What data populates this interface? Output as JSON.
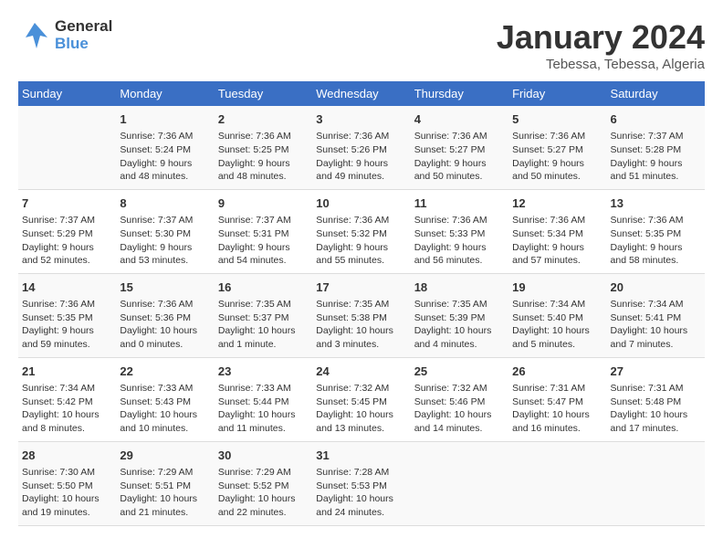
{
  "logo": {
    "general": "General",
    "blue": "Blue"
  },
  "title": "January 2024",
  "subtitle": "Tebessa, Tebessa, Algeria",
  "days_of_week": [
    "Sunday",
    "Monday",
    "Tuesday",
    "Wednesday",
    "Thursday",
    "Friday",
    "Saturday"
  ],
  "weeks": [
    [
      {
        "day": "",
        "info": ""
      },
      {
        "day": "1",
        "info": "Sunrise: 7:36 AM\nSunset: 5:24 PM\nDaylight: 9 hours\nand 48 minutes."
      },
      {
        "day": "2",
        "info": "Sunrise: 7:36 AM\nSunset: 5:25 PM\nDaylight: 9 hours\nand 48 minutes."
      },
      {
        "day": "3",
        "info": "Sunrise: 7:36 AM\nSunset: 5:26 PM\nDaylight: 9 hours\nand 49 minutes."
      },
      {
        "day": "4",
        "info": "Sunrise: 7:36 AM\nSunset: 5:27 PM\nDaylight: 9 hours\nand 50 minutes."
      },
      {
        "day": "5",
        "info": "Sunrise: 7:36 AM\nSunset: 5:27 PM\nDaylight: 9 hours\nand 50 minutes."
      },
      {
        "day": "6",
        "info": "Sunrise: 7:37 AM\nSunset: 5:28 PM\nDaylight: 9 hours\nand 51 minutes."
      }
    ],
    [
      {
        "day": "7",
        "info": "Sunrise: 7:37 AM\nSunset: 5:29 PM\nDaylight: 9 hours\nand 52 minutes."
      },
      {
        "day": "8",
        "info": "Sunrise: 7:37 AM\nSunset: 5:30 PM\nDaylight: 9 hours\nand 53 minutes."
      },
      {
        "day": "9",
        "info": "Sunrise: 7:37 AM\nSunset: 5:31 PM\nDaylight: 9 hours\nand 54 minutes."
      },
      {
        "day": "10",
        "info": "Sunrise: 7:36 AM\nSunset: 5:32 PM\nDaylight: 9 hours\nand 55 minutes."
      },
      {
        "day": "11",
        "info": "Sunrise: 7:36 AM\nSunset: 5:33 PM\nDaylight: 9 hours\nand 56 minutes."
      },
      {
        "day": "12",
        "info": "Sunrise: 7:36 AM\nSunset: 5:34 PM\nDaylight: 9 hours\nand 57 minutes."
      },
      {
        "day": "13",
        "info": "Sunrise: 7:36 AM\nSunset: 5:35 PM\nDaylight: 9 hours\nand 58 minutes."
      }
    ],
    [
      {
        "day": "14",
        "info": "Sunrise: 7:36 AM\nSunset: 5:35 PM\nDaylight: 9 hours\nand 59 minutes."
      },
      {
        "day": "15",
        "info": "Sunrise: 7:36 AM\nSunset: 5:36 PM\nDaylight: 10 hours\nand 0 minutes."
      },
      {
        "day": "16",
        "info": "Sunrise: 7:35 AM\nSunset: 5:37 PM\nDaylight: 10 hours\nand 1 minute."
      },
      {
        "day": "17",
        "info": "Sunrise: 7:35 AM\nSunset: 5:38 PM\nDaylight: 10 hours\nand 3 minutes."
      },
      {
        "day": "18",
        "info": "Sunrise: 7:35 AM\nSunset: 5:39 PM\nDaylight: 10 hours\nand 4 minutes."
      },
      {
        "day": "19",
        "info": "Sunrise: 7:34 AM\nSunset: 5:40 PM\nDaylight: 10 hours\nand 5 minutes."
      },
      {
        "day": "20",
        "info": "Sunrise: 7:34 AM\nSunset: 5:41 PM\nDaylight: 10 hours\nand 7 minutes."
      }
    ],
    [
      {
        "day": "21",
        "info": "Sunrise: 7:34 AM\nSunset: 5:42 PM\nDaylight: 10 hours\nand 8 minutes."
      },
      {
        "day": "22",
        "info": "Sunrise: 7:33 AM\nSunset: 5:43 PM\nDaylight: 10 hours\nand 10 minutes."
      },
      {
        "day": "23",
        "info": "Sunrise: 7:33 AM\nSunset: 5:44 PM\nDaylight: 10 hours\nand 11 minutes."
      },
      {
        "day": "24",
        "info": "Sunrise: 7:32 AM\nSunset: 5:45 PM\nDaylight: 10 hours\nand 13 minutes."
      },
      {
        "day": "25",
        "info": "Sunrise: 7:32 AM\nSunset: 5:46 PM\nDaylight: 10 hours\nand 14 minutes."
      },
      {
        "day": "26",
        "info": "Sunrise: 7:31 AM\nSunset: 5:47 PM\nDaylight: 10 hours\nand 16 minutes."
      },
      {
        "day": "27",
        "info": "Sunrise: 7:31 AM\nSunset: 5:48 PM\nDaylight: 10 hours\nand 17 minutes."
      }
    ],
    [
      {
        "day": "28",
        "info": "Sunrise: 7:30 AM\nSunset: 5:50 PM\nDaylight: 10 hours\nand 19 minutes."
      },
      {
        "day": "29",
        "info": "Sunrise: 7:29 AM\nSunset: 5:51 PM\nDaylight: 10 hours\nand 21 minutes."
      },
      {
        "day": "30",
        "info": "Sunrise: 7:29 AM\nSunset: 5:52 PM\nDaylight: 10 hours\nand 22 minutes."
      },
      {
        "day": "31",
        "info": "Sunrise: 7:28 AM\nSunset: 5:53 PM\nDaylight: 10 hours\nand 24 minutes."
      },
      {
        "day": "",
        "info": ""
      },
      {
        "day": "",
        "info": ""
      },
      {
        "day": "",
        "info": ""
      }
    ]
  ]
}
